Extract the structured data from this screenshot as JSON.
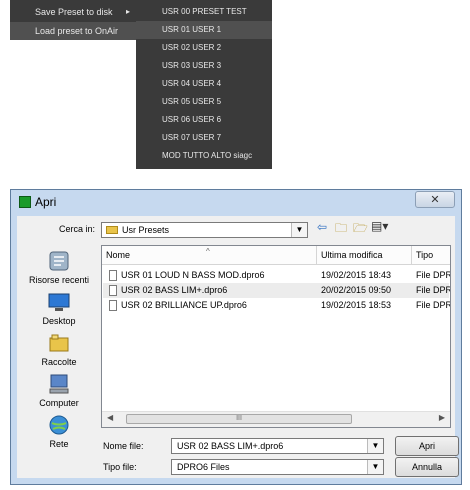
{
  "context_menu": {
    "items": [
      {
        "label": "Save Preset to disk",
        "has_submenu": true
      },
      {
        "label": "Load preset to OnAir",
        "has_submenu": false
      }
    ],
    "submenu_items": [
      "USR 00 PRESET TEST",
      "USR 01 USER 1",
      "USR 02 USER 2",
      "USR 03 USER 3",
      "USR 04 USER 4",
      "USR 05 USER 5",
      "USR 06 USER 6",
      "USR 07 USER 7",
      "MOD TUTTO ALTO siagc"
    ],
    "submenu_arrow": "▸"
  },
  "dialog": {
    "title": "Apri",
    "close_label": "✕",
    "look_in_label": "Cerca in:",
    "look_in_value": "Usr Presets",
    "places": [
      {
        "label": "Risorse recenti",
        "icon": "recent-places-icon"
      },
      {
        "label": "Desktop",
        "icon": "desktop-icon"
      },
      {
        "label": "Raccolte",
        "icon": "libraries-icon"
      },
      {
        "label": "Computer",
        "icon": "computer-icon"
      },
      {
        "label": "Rete",
        "icon": "network-icon"
      }
    ],
    "columns": [
      "Nome",
      "Ultima modifica",
      "Tipo"
    ],
    "files": [
      {
        "name": "USR 01 LOUD N BASS MOD.dpro6",
        "modified": "19/02/2015 18:43",
        "type": "File DPRO"
      },
      {
        "name": "USR 02 BASS LIM+.dpro6",
        "modified": "20/02/2015 09:50",
        "type": "File DPRO"
      },
      {
        "name": "USR 02 BRILLIANCE UP.dpro6",
        "modified": "19/02/2015 18:53",
        "type": "File DPRO"
      }
    ],
    "selected_file_index": 1,
    "scroll_thumb_label": "III",
    "filename_label": "Nome file:",
    "filename_value": "USR 02 BASS LIM+.dpro6",
    "filetype_label": "Tipo file:",
    "filetype_value": "DPRO6 Files",
    "open_button": "Apri",
    "cancel_button": "Annulla"
  }
}
